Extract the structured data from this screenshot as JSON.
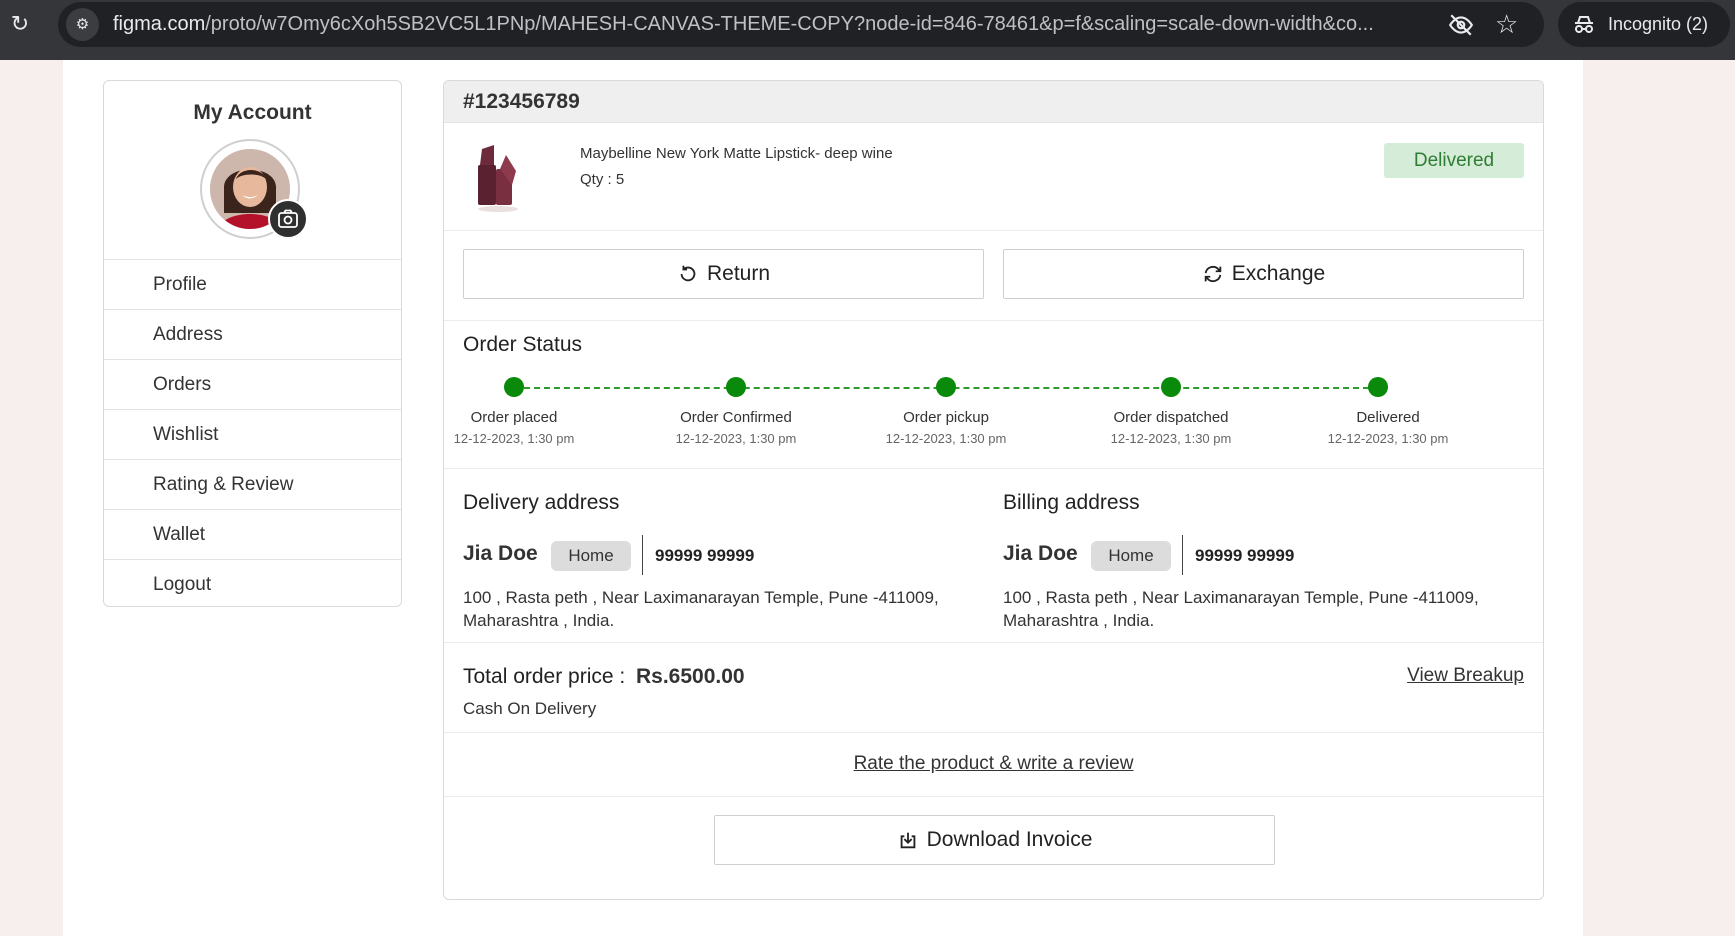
{
  "browser": {
    "url_host": "figma.com",
    "url_path": "/proto/w7Omy6cXoh5SB2VC5L1PNp/MAHESH-CANVAS-THEME-COPY?node-id=846-78461&p=f&scaling=scale-down-width&co...",
    "incognito_label": "Incognito (2)"
  },
  "sidebar": {
    "title": "My Account",
    "items": [
      {
        "label": "Profile"
      },
      {
        "label": "Address"
      },
      {
        "label": "Orders"
      },
      {
        "label": "Wishlist"
      },
      {
        "label": "Rating & Review"
      },
      {
        "label": "Wallet"
      },
      {
        "label": "Logout"
      }
    ]
  },
  "order": {
    "id": "#123456789",
    "product": {
      "name": "Maybelline New York Matte Lipstick-  deep wine",
      "qty": "Qty : 5"
    },
    "status_badge": "Delivered",
    "actions": {
      "return_label": "Return",
      "exchange_label": "Exchange"
    },
    "status": {
      "title": "Order Status",
      "steps": [
        {
          "label": "Order placed",
          "time": "12-12-2023, 1:30 pm"
        },
        {
          "label": "Order Confirmed",
          "time": "12-12-2023, 1:30 pm"
        },
        {
          "label": "Order pickup",
          "time": "12-12-2023, 1:30 pm"
        },
        {
          "label": "Order dispatched",
          "time": "12-12-2023, 1:30 pm"
        },
        {
          "label": "Delivered",
          "time": "12-12-2023, 1:30 pm"
        }
      ]
    },
    "delivery_address": {
      "title": "Delivery address",
      "name": "Jia Doe",
      "tag": "Home",
      "phone": "99999 99999",
      "line1": "100 , Rasta peth , Near Laximanarayan Temple, Pune -411009,",
      "line2": "Maharashtra , India."
    },
    "billing_address": {
      "title": "Billing address",
      "name": "Jia Doe",
      "tag": "Home",
      "phone": "99999 99999",
      "line1": "100 , Rasta peth , Near Laximanarayan Temple, Pune -411009,",
      "line2": "Maharashtra , India."
    },
    "price": {
      "label": "Total order price :",
      "value": "Rs.6500.00",
      "payment_mode": "Cash On Delivery",
      "breakup_label": "View Breakup"
    },
    "review_link": "Rate the product & write a review",
    "invoice_label": "Download Invoice"
  },
  "colors": {
    "accent_green": "#0a8a0a",
    "badge_bg": "#d5ecd8",
    "badge_text": "#2e7d32"
  }
}
